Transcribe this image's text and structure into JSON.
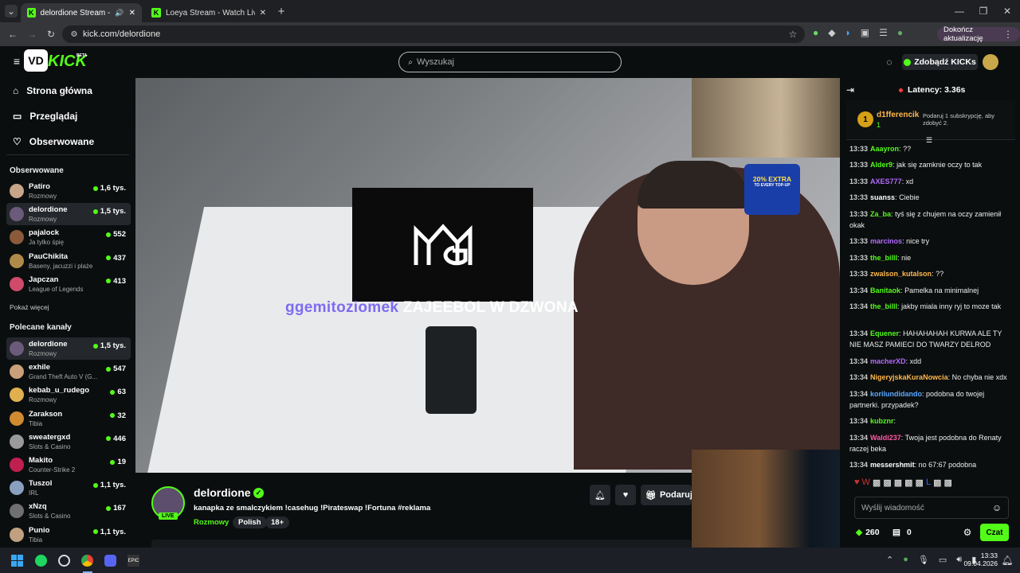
{
  "browser": {
    "tabs": [
      {
        "title": "delordione Stream - Watch",
        "active": true
      },
      {
        "title": "Loeya Stream - Watch Live on K",
        "active": false
      }
    ],
    "url": "kick.com/delordione",
    "update_label": "Dokończ aktualizację"
  },
  "header": {
    "logo": "KICK",
    "logo_badge": "BETA",
    "search_placeholder": "Wyszukaj",
    "kicks_label": "Zdobądź KICKs"
  },
  "sidebar": {
    "nav": [
      {
        "label": "Strona główna",
        "icon": "home-icon"
      },
      {
        "label": "Przeglądaj",
        "icon": "browse-icon"
      },
      {
        "label": "Obserwowane",
        "icon": "heart-icon"
      }
    ],
    "followed_heading": "Obserwowane",
    "followed": [
      {
        "name": "Patiro",
        "category": "Rozmowy",
        "viewers": "1,6 tys.",
        "color": "#c7a58a"
      },
      {
        "name": "delordione",
        "category": "Rozmowy",
        "viewers": "1,5 tys.",
        "color": "#6b5a7a",
        "selected": true
      },
      {
        "name": "pajalock",
        "category": "Ja tylko śpię",
        "viewers": "552",
        "color": "#8a5a3a"
      },
      {
        "name": "PauChikita",
        "category": "Baseny, jacuzzi i plaże",
        "viewers": "437",
        "color": "#b08a4a"
      },
      {
        "name": "Japczan",
        "category": "League of Legends",
        "viewers": "413",
        "color": "#d04a6a"
      }
    ],
    "show_more": "Pokaż więcej",
    "recommended_heading": "Polecane kanały",
    "recommended": [
      {
        "name": "delordione",
        "category": "Rozmowy",
        "viewers": "1,5 tys.",
        "color": "#6b5a7a",
        "selected": true
      },
      {
        "name": "exhile",
        "category": "Grand Theft Auto V (G...",
        "viewers": "547",
        "color": "#caa07a"
      },
      {
        "name": "kebab_u_rudego",
        "category": "Rozmowy",
        "viewers": "63",
        "color": "#e0b050"
      },
      {
        "name": "Zarakson",
        "category": "Tibia",
        "viewers": "32",
        "color": "#d08a30"
      },
      {
        "name": "sweatergxd",
        "category": "Slots & Casino",
        "viewers": "446",
        "color": "#9a9a9a"
      },
      {
        "name": "Makito",
        "category": "Counter-Strike 2",
        "viewers": "19",
        "color": "#c02050"
      },
      {
        "name": "Tuszol",
        "category": "IRL",
        "viewers": "1,1 tys.",
        "color": "#8aa0c0"
      },
      {
        "name": "xNzq",
        "category": "Slots & Casino",
        "viewers": "167",
        "color": "#707070"
      },
      {
        "name": "Punio",
        "category": "Tibia",
        "viewers": "1,1 tys.",
        "color": "#c0a080"
      }
    ]
  },
  "video": {
    "overlay_user": "ggemitoziomek",
    "overlay_text": "ZAJEEBOL W DZWONA",
    "promo_line1": "20% EXTRA",
    "promo_line2": "TO EVERY TOP-UP"
  },
  "stream": {
    "streamer": "delordione",
    "live_badge": "LIVE",
    "title": "kanapka ze smalczykiem !casehug !Pirateswap !Fortuna #reklama",
    "category": "Rozmowy",
    "tags": [
      "Polish",
      "18+"
    ],
    "gift_label": "Podaruj"
  },
  "chat": {
    "latency": "Latency: 3.36s",
    "pinned_user": "d1fferencik",
    "pinned_rank": "1",
    "pinned_count": "1",
    "pinned_text": "Podaruj 1 subskrypcję, aby zdobyć 2.",
    "messages": [
      {
        "time": "13:33",
        "user": "Aaayron",
        "text": "??",
        "color": "#53fc18"
      },
      {
        "time": "13:33",
        "user": "Alder9",
        "text": "jak się zamknie oczy to tak",
        "color": "#53fc18"
      },
      {
        "time": "13:33",
        "user": "AXES777",
        "text": "xd",
        "color": "#b36bff"
      },
      {
        "time": "13:33",
        "user": "suanss",
        "text": "Ciebie",
        "color": "#ffffff"
      },
      {
        "time": "13:33",
        "user": "Za_ba",
        "text": "tyś się z chujem na oczy zamienił okak",
        "color": "#53fc18"
      },
      {
        "time": "13:33",
        "user": "marcinos",
        "text": "nice try",
        "color": "#b36bff"
      },
      {
        "time": "13:33",
        "user": "the_billl",
        "text": "nie",
        "color": "#53fc18"
      },
      {
        "time": "13:33",
        "user": "zwalson_kutalson",
        "text": "??",
        "color": "#ffb84d"
      },
      {
        "time": "13:34",
        "user": "Banitaok",
        "text": "Pamelka na minimalnej",
        "color": "#53fc18"
      },
      {
        "time": "13:34",
        "user": "the_billl",
        "text": "jakby miala inny ryj to moze tak",
        "color": "#53fc18"
      },
      {
        "time": "13:34",
        "user": "Equener",
        "text": "HAHAHAHAH KURWA ALE TY NIE MASZ PAMIECI DO TWARZY DELROD",
        "color": "#53fc18"
      },
      {
        "time": "13:34",
        "user": "macherXD",
        "text": "xdd",
        "color": "#b36bff"
      },
      {
        "time": "13:34",
        "user": "NigeryjskaKuraNowcia",
        "text": "No chyba nie xdx",
        "color": "#ffb84d"
      },
      {
        "time": "13:34",
        "user": "korilundidando",
        "text": "podobna do twojej partnerki. przypadek?",
        "color": "#5aa8ff"
      },
      {
        "time": "13:34",
        "user": "kubznr",
        "text": "",
        "color": "#53fc18"
      },
      {
        "time": "13:34",
        "user": "Waldi237",
        "text": "Twoja jest podobna do Renaty raczej beka",
        "color": "#ff5aa8"
      },
      {
        "time": "13:34",
        "user": "messershmit",
        "text": "no 67:67 podobna",
        "color": "#ffffff"
      }
    ],
    "input_placeholder": "Wyślij wiadomość",
    "points": "260",
    "gifts": "0",
    "send_label": "Czat"
  },
  "taskbar": {
    "time": "13:33",
    "date": "09.04.2026"
  }
}
